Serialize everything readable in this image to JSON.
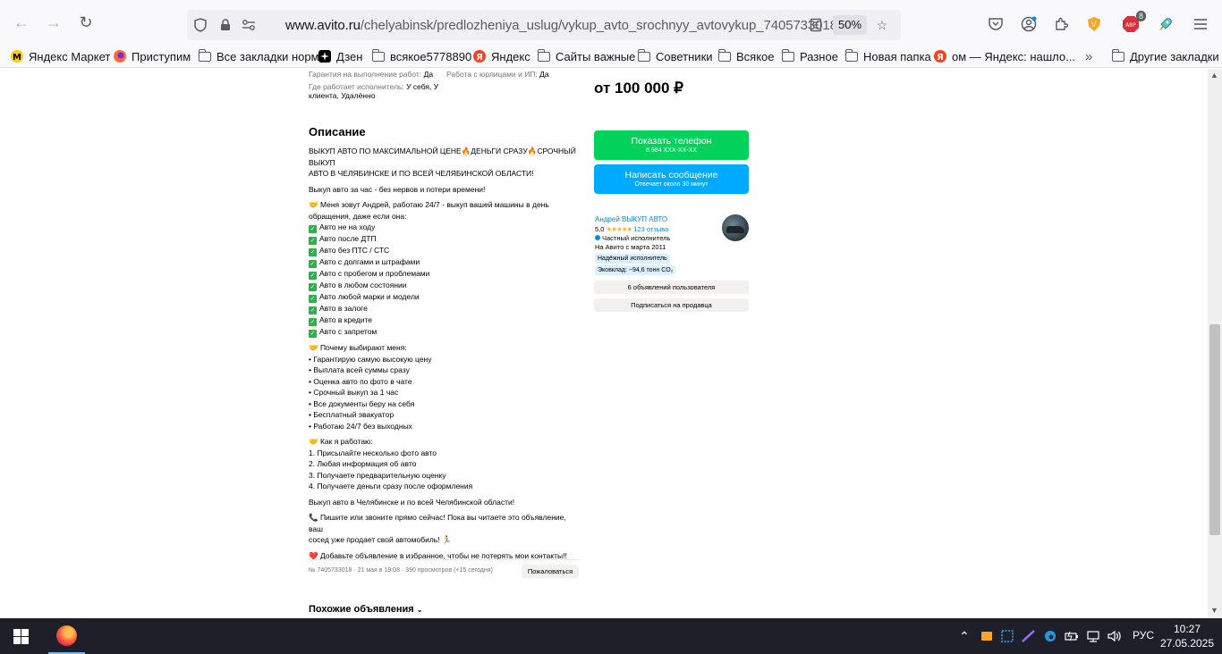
{
  "browser": {
    "url_domain": "www.avito.ru",
    "url_path": "/chelyabinsk/predlozheniya_uslug/vykup_avto_srochnyy_avtovykup_7405733018",
    "zoom": "50%",
    "extension_badge": "8"
  },
  "bookmarks": [
    {
      "label": "Яндекс Маркет",
      "icon": "yandex-market-icon"
    },
    {
      "label": "Приступим",
      "icon": "firefox-icon"
    },
    {
      "label": "Все закладки норм",
      "icon": "folder-icon"
    },
    {
      "label": "Дзен",
      "icon": "dzen-icon"
    },
    {
      "label": "всякое5778890",
      "icon": "folder-icon"
    },
    {
      "label": "Яндекс",
      "icon": "yandex-icon"
    },
    {
      "label": "Сайты важные",
      "icon": "folder-icon"
    },
    {
      "label": "Советники",
      "icon": "folder-icon"
    },
    {
      "label": "Всякое",
      "icon": "folder-icon"
    },
    {
      "label": "Разное",
      "icon": "folder-icon"
    },
    {
      "label": "Новая папка",
      "icon": "folder-icon"
    },
    {
      "label": "ом — Яндекс: нашло...",
      "icon": "yandex-icon"
    }
  ],
  "other_bookmarks": "Другие закладки",
  "params": {
    "guarantee_label": "Гарантия на выполнение работ:",
    "guarantee_value": "Да",
    "legal_label": "Работа с юрлицами и ИП:",
    "legal_value": "Да",
    "location_label": "Где работает исполнитель:",
    "location_value_1": "У себя, У",
    "location_value_2": "клиента, Удалённо"
  },
  "price": "от 100 000 ₽",
  "description": {
    "title": "Описание",
    "intro_1": "ВЫКУП АВТО ПО МАКСИМАЛЬНОЙ ЦЕНЕ🔥ДЕНЬГИ СРАЗУ🔥СРОЧНЫЙ ВЫКУП",
    "intro_2": "АВТО В ЧЕЛЯБИНСКЕ И ПО ВСЕЙ ЧЕЛЯБИНСКОЙ ОБЛАСТИ!",
    "tagline": "Выкуп авто за час - без нервов и потери времени!",
    "about_1": "🤝 Меня зовут Андрей, работаю 24/7 - выкуп вашей машины в день",
    "about_2": "обращения, даже если она:",
    "conditions": [
      "Авто не на ходу",
      "Авто после ДТП",
      "Авто без ПТС / СТС",
      "Авто с долгами и штрафами",
      "Авто с пробегом и проблемами",
      "Авто в любом состоянии",
      "Авто любой марки и модели",
      "Авто в залоге",
      "Авто в кредите",
      "Авто с запретом"
    ],
    "why_title": "🤝 Почему выбирают меня:",
    "why_items": [
      "• Гарантирую самую высокую цену",
      "• Выплата всей суммы сразу",
      "• Оценка авто по фото в чате",
      "• Срочный выкуп за 1 час",
      "• Все документы беру на себя",
      "• Бесплатный эвакуатор",
      "• Работаю 24/7 без выходных"
    ],
    "how_title": "🤝 Как я работаю:",
    "how_items": [
      "1. Присылайте несколько фото авто",
      "2. Любая информация об авто",
      "3. Получаете предварительную оценку",
      "4. Получаете деньги сразу после оформления"
    ],
    "region": "Выкуп авто в Челябинске и по всей Челябинской области!",
    "call_1": "📞 Пишите или звоните прямо сейчас! Пока вы читаете это объявление, ваш",
    "call_2": "сосед уже продает свой автомобиль! 🏃",
    "favorite": "❤️ Добавьте объявление в избранное, чтобы не потерять мои контакты!!"
  },
  "actions": {
    "show_phone": "Показать телефон",
    "phone_masked": "8 984 XXX-XX-XX",
    "write_message": "Написать сообщение",
    "response_time": "Отвечает около 30 минут"
  },
  "seller": {
    "name": "Андрей ВЫКУП АВТО",
    "rating": "5,0",
    "stars": "★★★★★",
    "reviews": "123 отзыва",
    "type": "Частный исполнитель",
    "since": "На Авито с марта 2011",
    "tag_reliable": "Надёжный исполнитель",
    "tag_eco": "Эковклад: ~94,6 тонн CO₂",
    "listings_button": "6 объявлений пользователя",
    "subscribe_button": "Подписаться на продавца"
  },
  "footer": {
    "meta": "№ 7405733018 · 21 мая в 19:08 · 390 просмотров (+15 сегодня)",
    "report": "Пожаловаться",
    "similar": "Похожие объявления"
  },
  "taskbar": {
    "lang": "РУС",
    "time": "10:27",
    "date": "27.05.2025"
  },
  "colors": {
    "green_button": "#02d15c",
    "blue_button": "#00aaff",
    "link": "#0a8bd8",
    "star": "#ffb021",
    "taskbar": "#1f1f2a"
  }
}
